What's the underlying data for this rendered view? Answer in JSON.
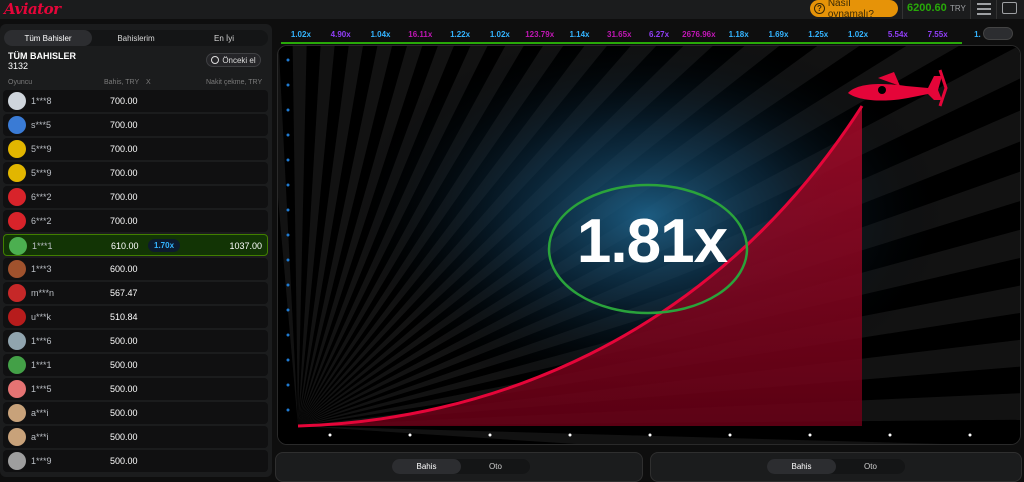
{
  "header": {
    "logo_text": "Aviator",
    "how_to_label": "Nasıl oynamalı?",
    "balance": "6200.60",
    "currency": "TRY"
  },
  "left_panel": {
    "tabs": [
      {
        "label": "Tüm Bahisler",
        "active": true
      },
      {
        "label": "Bahislerim",
        "active": false
      },
      {
        "label": "En İyi",
        "active": false
      }
    ],
    "title": "TÜM BAHISLER",
    "count": "3132",
    "prev_button_label": "Önceki el",
    "columns": {
      "player": "Oyuncu",
      "bet": "Bahis, TRY",
      "x": "X",
      "cashout": "Nakit çekme, TRY"
    },
    "rows": [
      {
        "player": "1***8",
        "bet": "700.00",
        "mult": "",
        "cashout": "",
        "avatar_color": "#cfd5dc",
        "win": false
      },
      {
        "player": "s***5",
        "bet": "700.00",
        "mult": "",
        "cashout": "",
        "avatar_color": "#3a7bd5",
        "win": false
      },
      {
        "player": "5***9",
        "bet": "700.00",
        "mult": "",
        "cashout": "",
        "avatar_color": "#e2b600",
        "win": false
      },
      {
        "player": "5***9",
        "bet": "700.00",
        "mult": "",
        "cashout": "",
        "avatar_color": "#e2b600",
        "win": false
      },
      {
        "player": "6***2",
        "bet": "700.00",
        "mult": "",
        "cashout": "",
        "avatar_color": "#d8232a",
        "win": false
      },
      {
        "player": "6***2",
        "bet": "700.00",
        "mult": "",
        "cashout": "",
        "avatar_color": "#d8232a",
        "win": false
      },
      {
        "player": "1***1",
        "bet": "610.00",
        "mult": "1.70x",
        "cashout": "1037.00",
        "avatar_color": "#4caf50",
        "win": true
      },
      {
        "player": "1***3",
        "bet": "600.00",
        "mult": "",
        "cashout": "",
        "avatar_color": "#a0522d",
        "win": false
      },
      {
        "player": "m***n",
        "bet": "567.47",
        "mult": "",
        "cashout": "",
        "avatar_color": "#c62828",
        "win": false
      },
      {
        "player": "u***k",
        "bet": "510.84",
        "mult": "",
        "cashout": "",
        "avatar_color": "#b71c1c",
        "win": false
      },
      {
        "player": "1***6",
        "bet": "500.00",
        "mult": "",
        "cashout": "",
        "avatar_color": "#90a4ae",
        "win": false
      },
      {
        "player": "1***1",
        "bet": "500.00",
        "mult": "",
        "cashout": "",
        "avatar_color": "#43a047",
        "win": false
      },
      {
        "player": "1***5",
        "bet": "500.00",
        "mult": "",
        "cashout": "",
        "avatar_color": "#e57373",
        "win": false
      },
      {
        "player": "a***i",
        "bet": "500.00",
        "mult": "",
        "cashout": "",
        "avatar_color": "#c8a27a",
        "win": false
      },
      {
        "player": "a***i",
        "bet": "500.00",
        "mult": "",
        "cashout": "",
        "avatar_color": "#c8a27a",
        "win": false
      },
      {
        "player": "1***9",
        "bet": "500.00",
        "mult": "",
        "cashout": "",
        "avatar_color": "#9e9e9e",
        "win": false
      }
    ]
  },
  "history": [
    {
      "v": "1.02x",
      "c": "#34b4ff"
    },
    {
      "v": "4.90x",
      "c": "#913ef8"
    },
    {
      "v": "1.04x",
      "c": "#34b4ff"
    },
    {
      "v": "16.11x",
      "c": "#c017b4"
    },
    {
      "v": "1.22x",
      "c": "#34b4ff"
    },
    {
      "v": "1.02x",
      "c": "#34b4ff"
    },
    {
      "v": "123.79x",
      "c": "#c017b4"
    },
    {
      "v": "1.14x",
      "c": "#34b4ff"
    },
    {
      "v": "31.65x",
      "c": "#c017b4"
    },
    {
      "v": "6.27x",
      "c": "#913ef8"
    },
    {
      "v": "2676.96x",
      "c": "#c017b4"
    },
    {
      "v": "1.18x",
      "c": "#34b4ff"
    },
    {
      "v": "1.69x",
      "c": "#34b4ff"
    },
    {
      "v": "1.25x",
      "c": "#34b4ff"
    },
    {
      "v": "1.02x",
      "c": "#34b4ff"
    },
    {
      "v": "5.54x",
      "c": "#913ef8"
    },
    {
      "v": "7.55x",
      "c": "#913ef8"
    },
    {
      "v": "1.",
      "c": "#34b4ff"
    }
  ],
  "game": {
    "multiplier": "1.81x"
  },
  "bet_panels": [
    {
      "tabs": [
        "Bahis",
        "Oto"
      ]
    },
    {
      "tabs": [
        "Bahis",
        "Oto"
      ]
    }
  ]
}
